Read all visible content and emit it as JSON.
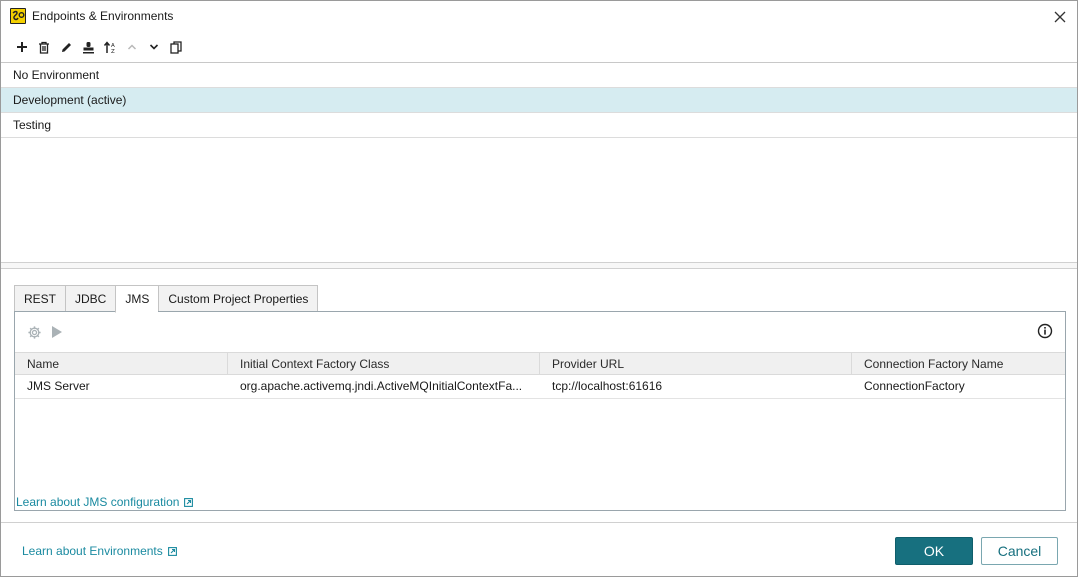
{
  "window": {
    "title": "Endpoints & Environments",
    "icon": "soapui-app-icon",
    "close": "close-icon"
  },
  "toolbar": {
    "buttons": [
      {
        "icon": "add-icon"
      },
      {
        "icon": "delete-icon"
      },
      {
        "icon": "edit-icon"
      },
      {
        "icon": "stamp-icon"
      },
      {
        "icon": "sort-icon"
      },
      {
        "icon": "move-up-icon"
      },
      {
        "icon": "move-down-icon"
      },
      {
        "icon": "copy-icon"
      }
    ]
  },
  "environments": [
    {
      "label": "No Environment",
      "active": false
    },
    {
      "label": "Development (active)",
      "active": true
    },
    {
      "label": "Testing",
      "active": false
    }
  ],
  "tabs": [
    {
      "label": "REST",
      "selected": false
    },
    {
      "label": "JDBC",
      "selected": false
    },
    {
      "label": "JMS",
      "selected": true
    },
    {
      "label": "Custom Project Properties",
      "selected": false
    }
  ],
  "jms_panel": {
    "tools": [
      "settings-icon",
      "run-icon"
    ],
    "info": "info-icon",
    "columns": [
      "Name",
      "Initial Context Factory Class",
      "Provider URL",
      "Connection Factory Name"
    ],
    "rows": [
      [
        "JMS Server",
        "org.apache.activemq.jndi.ActiveMQInitialContextFa...",
        "tcp://localhost:61616",
        "ConnectionFactory"
      ]
    ],
    "link": "Learn about JMS configuration"
  },
  "footer": {
    "link": "Learn about Environments",
    "ok": "OK",
    "cancel": "Cancel"
  },
  "colors": {
    "accent": "#17707f",
    "link": "#1a8aa0",
    "selected_row": "#d6ecf1"
  }
}
